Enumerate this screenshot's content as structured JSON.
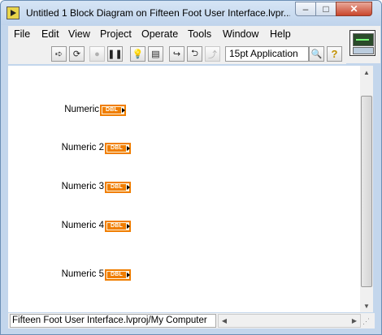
{
  "window": {
    "title": "Untitled 1 Block Diagram on Fifteen Foot User Interface.lvpr...",
    "controls": {
      "minimize": "–",
      "maximize": "□",
      "close": "✕"
    }
  },
  "menu": [
    "File",
    "Edit",
    "View",
    "Project",
    "Operate",
    "Tools",
    "Window",
    "Help"
  ],
  "toolbar": {
    "icons": {
      "run": "➪",
      "run_continuously": "⟳",
      "abort": "●",
      "pause": "❚❚",
      "highlight": "💡",
      "retain_wire_values": "▤",
      "step_into": "↪",
      "step_over": "⮌",
      "step_out": "⤴"
    },
    "font_dropdown": "15pt Application",
    "search_icon": "🔍",
    "help_glyph": "?"
  },
  "terminals": [
    {
      "label": "Numeric",
      "type_tag": "DBL"
    },
    {
      "label": "Numeric 2",
      "type_tag": "DBL"
    },
    {
      "label": "Numeric 3",
      "type_tag": "DBL"
    },
    {
      "label": "Numeric 4",
      "type_tag": "DBL"
    },
    {
      "label": "Numeric 5",
      "type_tag": "DBL"
    }
  ],
  "status": {
    "path": "Fifteen Foot User Interface.lvproj/My Computer"
  },
  "scroll_glyphs": {
    "up": "▲",
    "down": "▼",
    "left": "◀",
    "right": "▶",
    "grip": "⋰"
  },
  "colors": {
    "terminal_orange": "#f07e00",
    "title_bar": "#c3d6ec"
  }
}
